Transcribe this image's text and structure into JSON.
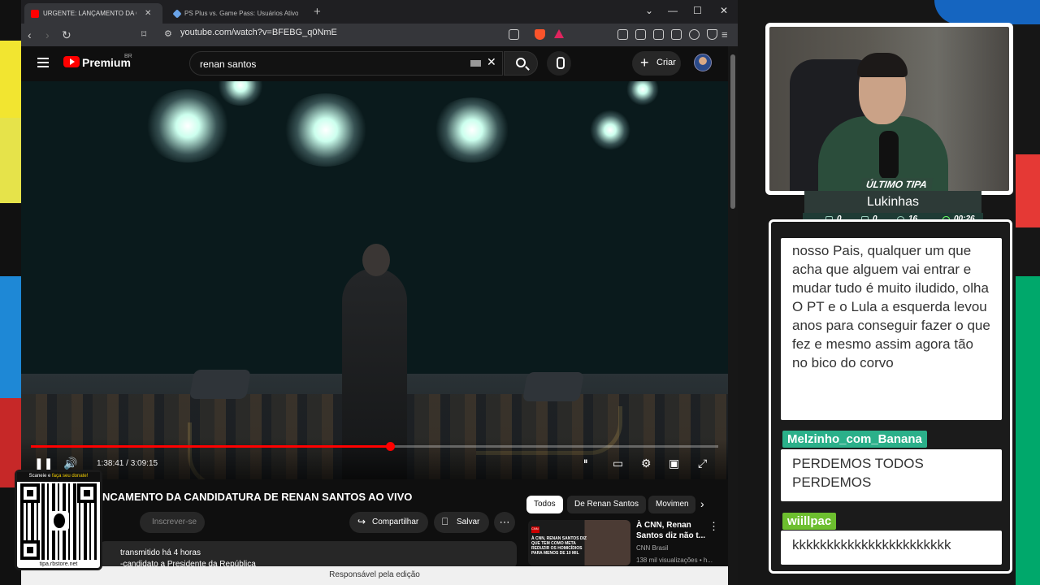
{
  "browser": {
    "tabs": [
      {
        "title": "URGENTE: LANÇAMENTO DA CANI",
        "active": true
      },
      {
        "title": "PS Plus vs. Game Pass: Usuários Ativos - Goo",
        "active": false
      }
    ],
    "url": "youtube.com/watch?v=BFEBG_q0NmE",
    "status_text": "Responsável pela edição"
  },
  "youtube": {
    "brand": "Premium",
    "region": "BR",
    "search_value": "renan santos",
    "create_label": "Criar",
    "video": {
      "current_time": "1:38:41",
      "duration": "3:09:15",
      "time_display": "1:38:41 / 3:09:15",
      "progress": 0.522
    },
    "title": "NCAMENTO DA CANDIDATURA DE RENAN SANTOS AO VIVO",
    "subscribe_label": "Inscrever-se",
    "share_label": "Compartilhar",
    "save_label": "Salvar",
    "more_label": "⋯",
    "description_line1": "transmitido há 4 horas",
    "description_line2": "-candidato a Presidente da República",
    "chips": [
      "Todos",
      "De Renan Santos",
      "Movimen"
    ],
    "recommendation": {
      "title": "À CNN, Renan Santos diz não t...",
      "channel": "CNN Brasil",
      "views": "138 mil visualizações • h...",
      "thumb_text": "À CNN, RENAN SANTOS DIZ QUE TEM COMO META REDUZIR OS HOMICÍDIOS PARA MENOS DE 10 MIL",
      "thumb_logo": "CNN"
    }
  },
  "qr": {
    "header_prefix": "Scaneie e ",
    "header_link": "faça seu donate!",
    "url": "tipa.rbstore.net"
  },
  "overlay": {
    "last_tip_label": "ÚLTIMO TIPA",
    "last_tip_name": "Lukinhas",
    "stats": [
      "0",
      "0",
      "16",
      "00:26"
    ]
  },
  "chat": {
    "messages": [
      {
        "user": "",
        "text": "nosso Pais, qualquer um que acha que alguem vai entrar e mudar tudo é muito iludido, olha O PT e o Lula a esquerda levou anos para conseguir fazer o que fez e mesmo assim agora tão no bico do corvo"
      },
      {
        "user": "Melzinho_com_Banana",
        "text": "PERDEMOS TODOS PERDEMOS"
      },
      {
        "user": "wiillpac",
        "text": "kkkkkkkkkkkkkkkkkkkkkkk"
      }
    ]
  },
  "colors": {
    "accent_red": "#ff0000",
    "chat_user_bg": "#2bb08a",
    "tip_green": "#2e4a3c"
  }
}
